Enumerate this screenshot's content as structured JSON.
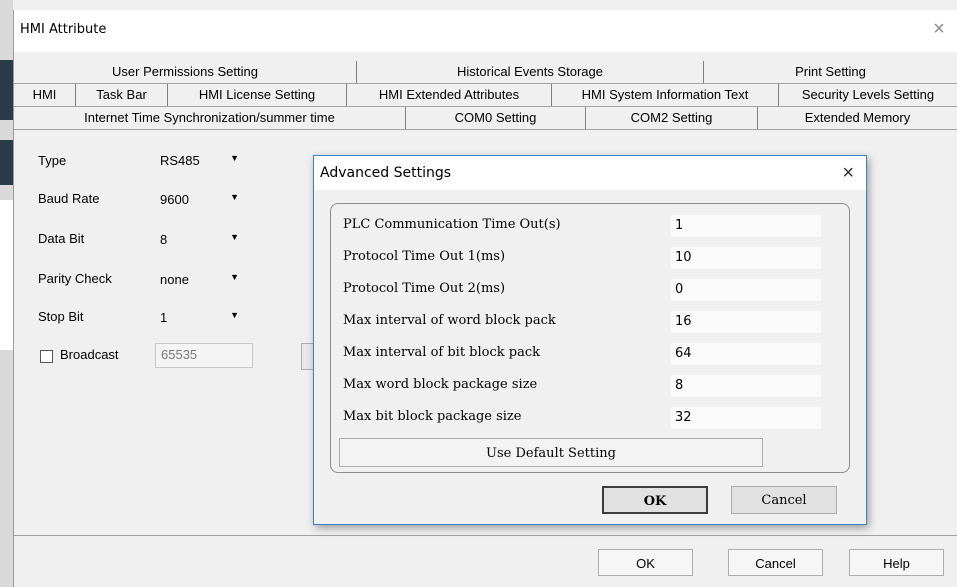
{
  "main": {
    "title": "HMI Attribute",
    "close_glyph": "×",
    "tabs_row1": [
      "User Permissions Setting",
      "Historical Events Storage",
      "Print Setting"
    ],
    "tabs_row2": [
      "HMI",
      "Task Bar",
      "HMI License Setting",
      "HMI Extended Attributes",
      "HMI System Information Text",
      "Security Levels Setting"
    ],
    "tabs_row3": [
      "Internet Time Synchronization/summer time",
      "COM0 Setting",
      "COM2 Setting",
      "Extended Memory"
    ],
    "active_tab": "COM0 Setting"
  },
  "form": {
    "type_label": "Type",
    "type_value": "RS485",
    "baud_label": "Baud Rate",
    "baud_value": "9600",
    "databit_label": "Data Bit",
    "databit_value": "8",
    "parity_label": "Parity Check",
    "parity_value": "none",
    "stopbit_label": "Stop Bit",
    "stopbit_value": "1",
    "broadcast_label": "Broadcast",
    "broadcast_value": "65535",
    "broadcast_checked": false
  },
  "advanced": {
    "title": "Advanced Settings",
    "close_glyph": "×",
    "rows": [
      {
        "label": "PLC Communication Time Out(s)",
        "value": "1"
      },
      {
        "label": "Protocol Time Out 1(ms)",
        "value": "10"
      },
      {
        "label": "Protocol Time Out 2(ms)",
        "value": "0"
      },
      {
        "label": "Max interval of word block pack",
        "value": "16"
      },
      {
        "label": "Max interval of bit block pack",
        "value": "64"
      },
      {
        "label": "Max word block package size",
        "value": "8"
      },
      {
        "label": "Max bit block package size",
        "value": "32"
      }
    ],
    "default_button": "Use Default Setting",
    "ok_button": "OK",
    "cancel_button": "Cancel"
  },
  "footer": {
    "ok": "OK",
    "cancel": "Cancel",
    "help": "Help"
  },
  "icons": {
    "dropdown_arrow": "chevron-down-icon",
    "close": "close-icon"
  }
}
